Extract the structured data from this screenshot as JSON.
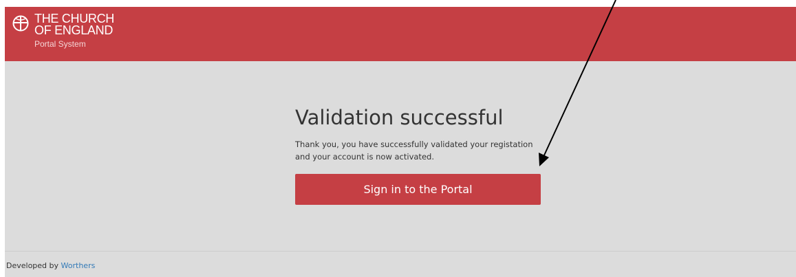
{
  "header": {
    "logo_line1": "THE CHURCH",
    "logo_line2": "OF ENGLAND",
    "subtitle": "Portal System",
    "logo_icon": "cross-circle-icon",
    "background_color": "#c53f44"
  },
  "main": {
    "title": "Validation successful",
    "message": "Thank you, you have successfully validated your registation and your account is now activated.",
    "signin_button_label": "Sign in to the Portal"
  },
  "footer": {
    "developed_by": "Developed by",
    "developer_link": "Worthers"
  },
  "annotation": {
    "arrow_icon": "arrow-pointer-icon"
  },
  "colors": {
    "brand_red": "#c53f44",
    "page_background": "#dcdcdc",
    "link_blue": "#337ab7"
  }
}
